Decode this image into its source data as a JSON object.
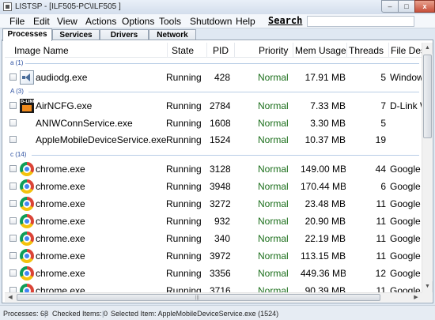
{
  "window": {
    "title": "LISTSP - [ILF505-PC\\ILF505 ]",
    "minimize": "–",
    "maximize": "□",
    "close": "x"
  },
  "menu": {
    "items": [
      "File",
      "Edit",
      "View",
      "Actions",
      "Options",
      "Tools",
      "Shutdown",
      "Help"
    ],
    "search_label": "Search",
    "search_value": ""
  },
  "tabs": [
    {
      "label": "Processes",
      "active": true
    },
    {
      "label": "Services",
      "active": false
    },
    {
      "label": "Drivers",
      "active": false
    },
    {
      "label": "Network",
      "active": false
    }
  ],
  "columns": [
    "Image Name",
    "State",
    "PID",
    "Priority",
    "Mem Usage",
    "Threads",
    "File Des"
  ],
  "groups": [
    {
      "label": "a (1)"
    },
    {
      "label": "A (3)"
    },
    {
      "label": "c (14)"
    }
  ],
  "rows": [
    {
      "icon": "audio-icon",
      "name": "audiodg.exe",
      "state": "Running",
      "pid": "428",
      "priority": "Normal",
      "mem": "17.91 MB",
      "threads": "5",
      "desc": "Windows"
    },
    {
      "icon": "dlink-icon",
      "name": "AirNCFG.exe",
      "state": "Running",
      "pid": "2784",
      "priority": "Normal",
      "mem": "7.33 MB",
      "threads": "7",
      "desc": "D-Link W"
    },
    {
      "icon": "",
      "name": "ANIWConnService.exe",
      "state": "Running",
      "pid": "1608",
      "priority": "Normal",
      "mem": "3.30 MB",
      "threads": "5",
      "desc": ""
    },
    {
      "icon": "",
      "name": "AppleMobileDeviceService.exe",
      "state": "Running",
      "pid": "1524",
      "priority": "Normal",
      "mem": "10.37 MB",
      "threads": "19",
      "desc": ""
    },
    {
      "icon": "chrome-icon",
      "name": "chrome.exe",
      "state": "Running",
      "pid": "3128",
      "priority": "Normal",
      "mem": "149.00 MB",
      "threads": "44",
      "desc": "Google C"
    },
    {
      "icon": "chrome-icon",
      "name": "chrome.exe",
      "state": "Running",
      "pid": "3948",
      "priority": "Normal",
      "mem": "170.44 MB",
      "threads": "6",
      "desc": "Google C"
    },
    {
      "icon": "chrome-icon",
      "name": "chrome.exe",
      "state": "Running",
      "pid": "3272",
      "priority": "Normal",
      "mem": "23.48 MB",
      "threads": "11",
      "desc": "Google C"
    },
    {
      "icon": "chrome-icon",
      "name": "chrome.exe",
      "state": "Running",
      "pid": "932",
      "priority": "Normal",
      "mem": "20.90 MB",
      "threads": "11",
      "desc": "Google C"
    },
    {
      "icon": "chrome-icon",
      "name": "chrome.exe",
      "state": "Running",
      "pid": "340",
      "priority": "Normal",
      "mem": "22.19 MB",
      "threads": "11",
      "desc": "Google C"
    },
    {
      "icon": "chrome-icon",
      "name": "chrome.exe",
      "state": "Running",
      "pid": "3972",
      "priority": "Normal",
      "mem": "113.15 MB",
      "threads": "11",
      "desc": "Google C"
    },
    {
      "icon": "chrome-icon",
      "name": "chrome.exe",
      "state": "Running",
      "pid": "3356",
      "priority": "Normal",
      "mem": "449.36 MB",
      "threads": "12",
      "desc": "Google C"
    },
    {
      "icon": "chrome-icon",
      "name": "chrome.exe",
      "state": "Running",
      "pid": "3716",
      "priority": "Normal",
      "mem": "90.39 MB",
      "threads": "11",
      "desc": "Google C"
    }
  ],
  "status": {
    "processes": "Processes: 68",
    "checked": "Checked Items: 0",
    "selected": "Selected Item: AppleMobileDeviceService.exe (1524)",
    "separator": "|"
  },
  "colors": {
    "priority_text": "#1a6e1a",
    "group_label": "#2b4fa0"
  }
}
